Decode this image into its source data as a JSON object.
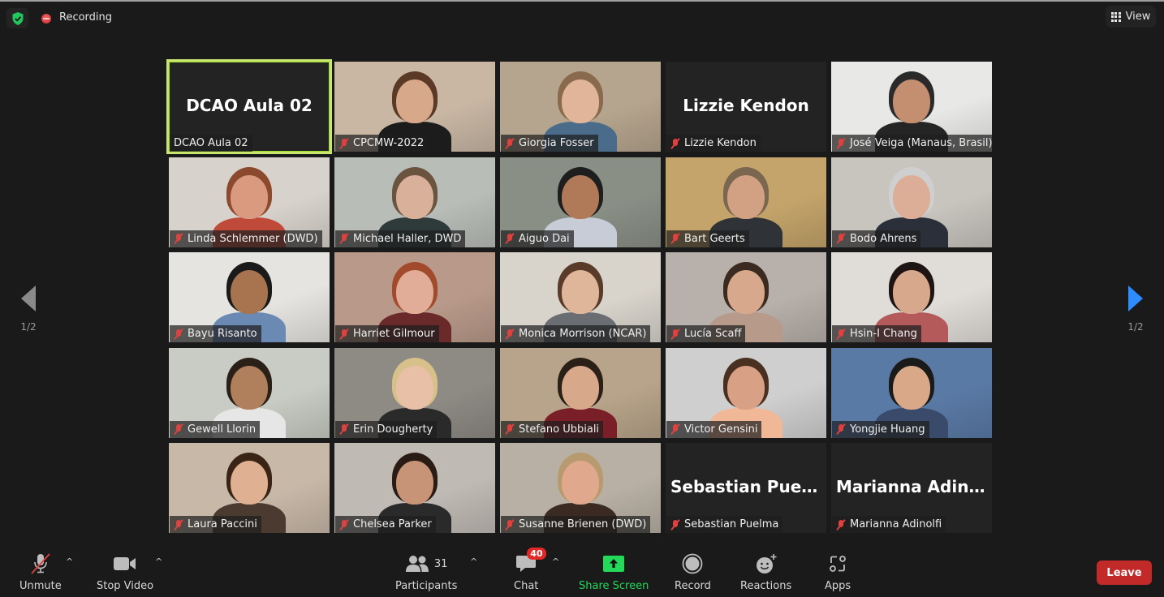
{
  "top_bar": {
    "security_icon": "shield-check-icon",
    "recording_label": "Recording",
    "view_label": "View"
  },
  "nav": {
    "prev_page": "1/2",
    "next_page": "1/2"
  },
  "tiles": [
    {
      "display": "DCAO Aula 02",
      "name": "DCAO Aula 02",
      "video": false,
      "muted": false,
      "active": true
    },
    {
      "display": "",
      "name": "CPCMW-2022",
      "video": true,
      "muted": true,
      "bg": "#c9b7a4",
      "skin": "#d8a88a",
      "hair": "#5a3a26",
      "shirt": "#1c1c1c"
    },
    {
      "display": "",
      "name": "Giorgia Fosser",
      "video": true,
      "muted": true,
      "bg": "#b6a58e",
      "skin": "#e0b59a",
      "hair": "#8a6a4c",
      "shirt": "#4a6b8a"
    },
    {
      "display": "Lizzie Kendon",
      "name": "Lizzie Kendon",
      "video": false,
      "muted": true
    },
    {
      "display": "",
      "name": "José Veiga (Manaus, Brasil)",
      "video": true,
      "muted": true,
      "bg": "#e8e8e6",
      "skin": "#c48e70",
      "hair": "#2a2a2a",
      "shirt": "#252525"
    },
    {
      "display": "",
      "name": "Linda Schlemmer (DWD)",
      "video": true,
      "muted": true,
      "bg": "#d8d2cc",
      "skin": "#d99a80",
      "hair": "#8b4a2e",
      "shirt": "#c04a3a"
    },
    {
      "display": "",
      "name": "Michael Haller, DWD",
      "video": true,
      "muted": true,
      "bg": "#b9bdb8",
      "skin": "#d9b09a",
      "hair": "#6a5440",
      "shirt": "#2f3a3a"
    },
    {
      "display": "",
      "name": "Aiguo Dai",
      "video": true,
      "muted": true,
      "bg": "#8a8f86",
      "skin": "#b07a58",
      "hair": "#1e1e1e",
      "shirt": "#c8ccd6"
    },
    {
      "display": "",
      "name": "Bart Geerts",
      "video": true,
      "muted": true,
      "bg": "#c4a46a",
      "skin": "#d2a184",
      "hair": "#7b6650",
      "shirt": "#2f3236"
    },
    {
      "display": "",
      "name": "Bodo Ahrens",
      "video": true,
      "muted": true,
      "bg": "#c8c4be",
      "skin": "#dcae98",
      "hair": "#cfcfcf",
      "shirt": "#2a2f3a"
    },
    {
      "display": "",
      "name": "Bayu Risanto",
      "video": true,
      "muted": true,
      "bg": "#e6e4e0",
      "skin": "#a8734f",
      "hair": "#1a1a1a",
      "shirt": "#6a8ab4"
    },
    {
      "display": "",
      "name": "Harriet Gilmour",
      "video": true,
      "muted": true,
      "bg": "#b99a8a",
      "skin": "#e2ad98",
      "hair": "#a24a2c",
      "shirt": "#6a2a2a"
    },
    {
      "display": "",
      "name": "Monica Morrison (NCAR)",
      "video": true,
      "muted": true,
      "bg": "#d8d4cc",
      "skin": "#e0b69a",
      "hair": "#5a3a28",
      "shirt": "#6a6e72"
    },
    {
      "display": "",
      "name": "Lucía Scaff",
      "video": true,
      "muted": true,
      "bg": "#b8b0aa",
      "skin": "#d8a88c",
      "hair": "#3a2a20",
      "shirt": "#b89a8a"
    },
    {
      "display": "",
      "name": "Hsin-I Chang",
      "video": true,
      "muted": true,
      "bg": "#e0dcd8",
      "skin": "#d8a88c",
      "hair": "#1e1414",
      "shirt": "#b45a5a"
    },
    {
      "display": "",
      "name": "Gewell Llorin",
      "video": true,
      "muted": true,
      "bg": "#c8ccc4",
      "skin": "#b0805c",
      "hair": "#2a2018",
      "shirt": "#e6e6e6"
    },
    {
      "display": "",
      "name": "Erin Dougherty",
      "video": true,
      "muted": true,
      "bg": "#8e8a84",
      "skin": "#e8c0a8",
      "hair": "#d8c08a",
      "shirt": "#2a2a2a"
    },
    {
      "display": "",
      "name": "Stefano Ubbiali",
      "video": true,
      "muted": true,
      "bg": "#b8a48a",
      "skin": "#d8a88a",
      "hair": "#2a2018",
      "shirt": "#7a1e28"
    },
    {
      "display": "",
      "name": "Victor Gensini",
      "video": true,
      "muted": true,
      "bg": "#cfcfcf",
      "skin": "#d8a084",
      "hair": "#4a3020",
      "shirt": "#f0b896"
    },
    {
      "display": "",
      "name": "Yongjie Huang",
      "video": true,
      "muted": true,
      "bg": "#5a7aa6",
      "skin": "#d8a888",
      "hair": "#1a1a1a",
      "shirt": "#3a4a6a"
    },
    {
      "display": "",
      "name": "Laura Paccini",
      "video": true,
      "muted": true,
      "bg": "#c8b8a8",
      "skin": "#e0b092",
      "hair": "#3a2416",
      "shirt": "#4a3a30"
    },
    {
      "display": "",
      "name": "Chelsea Parker",
      "video": true,
      "muted": true,
      "bg": "#c0bab4",
      "skin": "#c89478",
      "hair": "#2a1c14",
      "shirt": "#2a2a2a"
    },
    {
      "display": "",
      "name": "Susanne Brienen (DWD)",
      "video": true,
      "muted": true,
      "bg": "#b8b0a4",
      "skin": "#e0a88c",
      "hair": "#b89a70",
      "shirt": "#3a2a22"
    },
    {
      "display": "Sebastian Puelma",
      "name": "Sebastian Puelma",
      "video": false,
      "muted": true
    },
    {
      "display": "Marianna  Adin...",
      "name": "Marianna Adinolfi",
      "video": false,
      "muted": true
    }
  ],
  "toolbar": {
    "unmute_label": "Unmute",
    "stop_video_label": "Stop Video",
    "participants_label": "Participants",
    "participants_count": "31",
    "chat_label": "Chat",
    "chat_badge": "40",
    "share_screen_label": "Share Screen",
    "record_label": "Record",
    "reactions_label": "Reactions",
    "apps_label": "Apps",
    "leave_label": "Leave",
    "caret": "^"
  },
  "colors": {
    "background": "#1a1a1a",
    "active_speaker": "#c8e66e",
    "share_green": "#23d959",
    "leave_red": "#c22a2a",
    "badge_red": "#e02828",
    "nav_blue": "#2d8cff",
    "muted_red": "#e0413f"
  }
}
